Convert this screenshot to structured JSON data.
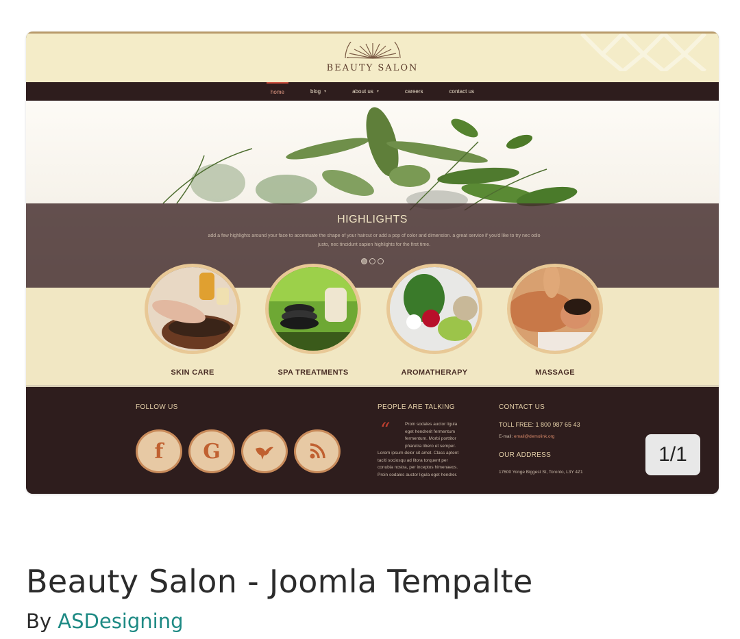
{
  "preview": {
    "site_logo": "BEAUTY SALON",
    "nav": [
      {
        "label": "home",
        "active": true,
        "dropdown": false
      },
      {
        "label": "blog",
        "active": false,
        "dropdown": true
      },
      {
        "label": "about us",
        "active": false,
        "dropdown": true
      },
      {
        "label": "careers",
        "active": false,
        "dropdown": false
      },
      {
        "label": "contact us",
        "active": false,
        "dropdown": false
      }
    ],
    "highlight": {
      "title": "HIGHLIGHTS",
      "text_line1": "add a few highlights around your face to accentuate the shape of your haircut or add a pop of color and dimension. a great service if you'd like to try nec odio",
      "text_line2": "justo, nec tincidunt sapien highlights for the first time.",
      "slides_total": 3,
      "slide_active": 1
    },
    "services": [
      {
        "label": "SKIN CARE"
      },
      {
        "label": "SPA TREATMENTS"
      },
      {
        "label": "AROMATHERAPY"
      },
      {
        "label": "MASSAGE"
      }
    ],
    "footer": {
      "follow_heading": "FOLLOW US",
      "social": [
        {
          "icon": "facebook-icon",
          "glyph": "f"
        },
        {
          "icon": "google-icon",
          "glyph": "G"
        },
        {
          "icon": "bird-icon",
          "glyph": ""
        },
        {
          "icon": "rss-icon",
          "glyph": ""
        }
      ],
      "talking_heading": "PEOPLE ARE TALKING",
      "quote_lines": [
        "Proin sodales auctor ligula",
        "eget hendrerit fermentum",
        "fermentum. Morbi porttitor",
        "pharetra libero et semper.",
        "Lorem ipsum dolor sit amet. Class aptent",
        "taciti sociosqu ad litora torquent per",
        "conubia nostra, per inceptos himenaeos.",
        "Proin sodales auctor ligula eget hendrer."
      ],
      "contact_heading": "CONTACT US",
      "toll_free": "TOLL FREE: 1 800 987 65 43",
      "email_label": "E-mail:",
      "email": "email@demolink.org",
      "address_heading": "OUR ADDRESS",
      "address": "17600 Yonge Biggest St, Toronto, L3Y 4Z1"
    },
    "counter": "1/1"
  },
  "listing": {
    "title": "Beauty Salon - Joomla Tempalte",
    "by_label": "By",
    "author": "ASDesigning"
  },
  "colors": {
    "accent_teal": "#1e8a84",
    "footer_bg": "#2e1d1d",
    "cream": "#f1e7c3"
  }
}
